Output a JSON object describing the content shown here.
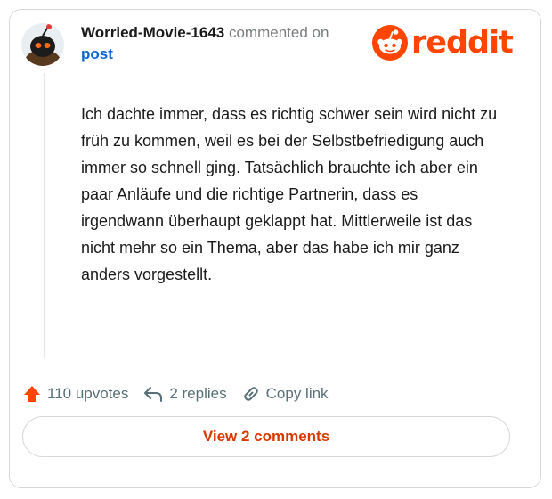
{
  "comment": {
    "username": "Worried-Movie-1643",
    "action_text": "commented on",
    "post_link": "post",
    "body": "Ich dachte immer, dass es richtig schwer sein wird nicht zu früh zu kommen, weil es bei der Selbstbefriedigung auch immer so schnell ging. Tatsächlich brauchte ich aber ein paar Anläufe und die richtige Partnerin, dass es irgendwann überhaupt geklappt hat. Mittlerweile ist das nicht mehr so ein Thema, aber das habe ich mir ganz anders vorgestellt."
  },
  "brand": {
    "logo_text": "reddit",
    "color": "#ff4500"
  },
  "actions": {
    "upvotes_label": "110 upvotes",
    "replies_label": "2 replies",
    "copy_label": "Copy link"
  },
  "footer": {
    "view_comments_label": "View 2 comments"
  },
  "colors": {
    "link": "#0a66d1",
    "accent": "#ff4500",
    "button_text": "#d93900",
    "muted": "#576f76"
  },
  "icons": [
    "avatar",
    "reddit-snoo-icon",
    "upvote-arrow-icon",
    "reply-arrow-icon",
    "link-icon"
  ]
}
